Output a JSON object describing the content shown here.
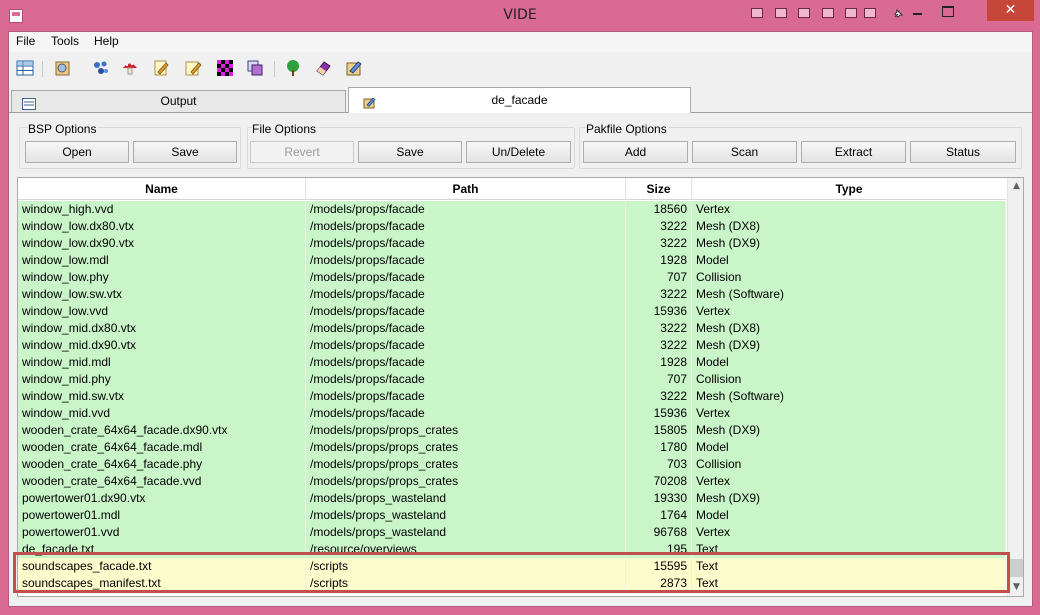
{
  "window": {
    "title": "VIDE",
    "close_glyph": "✕"
  },
  "menu": [
    "File",
    "Tools",
    "Help"
  ],
  "toolbar_icons": [
    "grid-view-icon",
    "open-bsp-icon",
    "molecule-icon",
    "mushroom-icon",
    "edit-notepad-icon",
    "edit-notepad-2-icon",
    "checker-texture-icon",
    "layers-icon",
    "tree-icon",
    "eraser-icon",
    "package-icon"
  ],
  "tabs": [
    {
      "label": "Output",
      "active": false
    },
    {
      "label": "de_facade",
      "active": true
    }
  ],
  "groups": {
    "bsp": {
      "label": "BSP Options",
      "buttons": [
        "Open",
        "Save"
      ]
    },
    "file": {
      "label": "File Options",
      "buttons": [
        "Revert",
        "Save",
        "Un/Delete"
      ]
    },
    "pak": {
      "label": "Pakfile Options",
      "buttons": [
        "Add",
        "Scan",
        "Extract",
        "Status"
      ]
    }
  },
  "table": {
    "headers": {
      "name": "Name",
      "path": "Path",
      "size": "Size",
      "type": "Type"
    },
    "rows": [
      {
        "name": "window_high.vvd",
        "path": "/models/props/facade",
        "size": "18560",
        "type": "Vertex",
        "color": "green"
      },
      {
        "name": "window_low.dx80.vtx",
        "path": "/models/props/facade",
        "size": "3222",
        "type": "Mesh (DX8)",
        "color": "green"
      },
      {
        "name": "window_low.dx90.vtx",
        "path": "/models/props/facade",
        "size": "3222",
        "type": "Mesh (DX9)",
        "color": "green"
      },
      {
        "name": "window_low.mdl",
        "path": "/models/props/facade",
        "size": "1928",
        "type": "Model",
        "color": "green"
      },
      {
        "name": "window_low.phy",
        "path": "/models/props/facade",
        "size": "707",
        "type": "Collision",
        "color": "green"
      },
      {
        "name": "window_low.sw.vtx",
        "path": "/models/props/facade",
        "size": "3222",
        "type": "Mesh (Software)",
        "color": "green"
      },
      {
        "name": "window_low.vvd",
        "path": "/models/props/facade",
        "size": "15936",
        "type": "Vertex",
        "color": "green"
      },
      {
        "name": "window_mid.dx80.vtx",
        "path": "/models/props/facade",
        "size": "3222",
        "type": "Mesh (DX8)",
        "color": "green"
      },
      {
        "name": "window_mid.dx90.vtx",
        "path": "/models/props/facade",
        "size": "3222",
        "type": "Mesh (DX9)",
        "color": "green"
      },
      {
        "name": "window_mid.mdl",
        "path": "/models/props/facade",
        "size": "1928",
        "type": "Model",
        "color": "green"
      },
      {
        "name": "window_mid.phy",
        "path": "/models/props/facade",
        "size": "707",
        "type": "Collision",
        "color": "green"
      },
      {
        "name": "window_mid.sw.vtx",
        "path": "/models/props/facade",
        "size": "3222",
        "type": "Mesh (Software)",
        "color": "green"
      },
      {
        "name": "window_mid.vvd",
        "path": "/models/props/facade",
        "size": "15936",
        "type": "Vertex",
        "color": "green"
      },
      {
        "name": "wooden_crate_64x64_facade.dx90.vtx",
        "path": "/models/props/props_crates",
        "size": "15805",
        "type": "Mesh (DX9)",
        "color": "green"
      },
      {
        "name": "wooden_crate_64x64_facade.mdl",
        "path": "/models/props/props_crates",
        "size": "1780",
        "type": "Model",
        "color": "green"
      },
      {
        "name": "wooden_crate_64x64_facade.phy",
        "path": "/models/props/props_crates",
        "size": "703",
        "type": "Collision",
        "color": "green"
      },
      {
        "name": "wooden_crate_64x64_facade.vvd",
        "path": "/models/props/props_crates",
        "size": "70208",
        "type": "Vertex",
        "color": "green"
      },
      {
        "name": "powertower01.dx90.vtx",
        "path": "/models/props_wasteland",
        "size": "19330",
        "type": "Mesh (DX9)",
        "color": "green"
      },
      {
        "name": "powertower01.mdl",
        "path": "/models/props_wasteland",
        "size": "1764",
        "type": "Model",
        "color": "green"
      },
      {
        "name": "powertower01.vvd",
        "path": "/models/props_wasteland",
        "size": "96768",
        "type": "Vertex",
        "color": "green"
      },
      {
        "name": "de_facade.txt",
        "path": "/resource/overviews",
        "size": "195",
        "type": "Text",
        "color": "green"
      },
      {
        "name": "soundscapes_facade.txt",
        "path": "/scripts",
        "size": "15595",
        "type": "Text",
        "color": "yellow"
      },
      {
        "name": "soundscapes_manifest.txt",
        "path": "/scripts",
        "size": "2873",
        "type": "Text",
        "color": "yellow"
      }
    ]
  },
  "colors": {
    "row_green": "#c9f5c9",
    "row_yellow": "#fdfccd",
    "highlight": "#c0504d",
    "titlebar": "#d96a91"
  }
}
